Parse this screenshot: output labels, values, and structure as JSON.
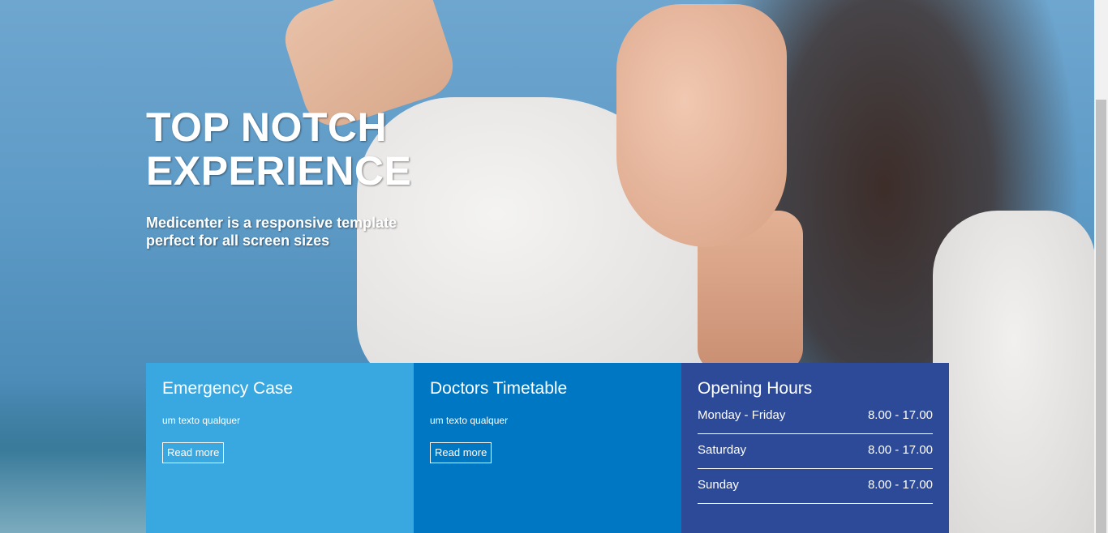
{
  "hero": {
    "title": "TOP NOTCH EXPERIENCE",
    "subtitle": "Medicenter is a responsive template perfect for all screen sizes"
  },
  "cards": {
    "emergency": {
      "title": "Emergency Case",
      "text": "um texto qualquer",
      "button": "Read more",
      "color": "#3aa8e0"
    },
    "doctors": {
      "title": "Doctors Timetable",
      "text": "um texto qualquer",
      "button": "Read more",
      "color": "#0077c2"
    },
    "hours": {
      "title": "Opening Hours",
      "color": "#2d4a99",
      "rows": [
        {
          "day": "Monday - Friday",
          "time": "8.00 - 17.00"
        },
        {
          "day": "Saturday",
          "time": "8.00 - 17.00"
        },
        {
          "day": "Sunday",
          "time": "8.00 - 17.00"
        }
      ]
    }
  }
}
